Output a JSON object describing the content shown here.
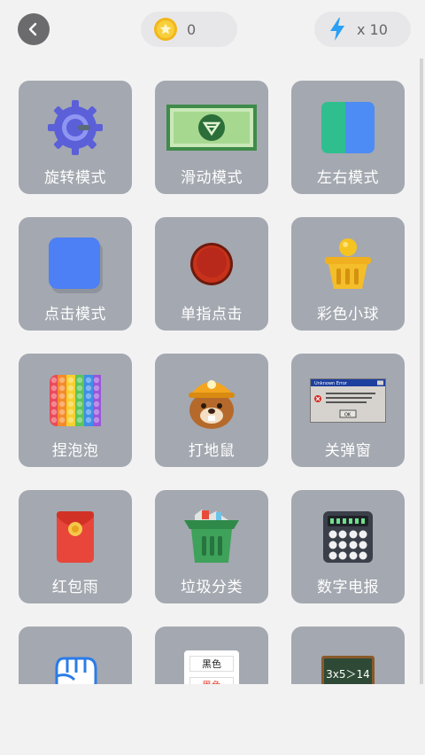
{
  "header": {
    "back_icon": "chevron-left-icon",
    "coins": {
      "icon": "coin-star-icon",
      "value": "0"
    },
    "energy": {
      "icon": "lightning-icon",
      "value": "x 10"
    }
  },
  "colors": {
    "background": "#f2f2f3",
    "card": "#a4a8b0",
    "back_button": "#6b6b6d",
    "pill": "#e7e7e9",
    "energy": "#2aa0f5",
    "coin": "#f4c12a"
  },
  "modes": [
    {
      "label": "旋转模式",
      "icon": "gear-icon"
    },
    {
      "label": "滑动模式",
      "icon": "banknote-icon"
    },
    {
      "label": "左右模式",
      "icon": "split-blocks-icon"
    },
    {
      "label": "点击模式",
      "icon": "blue-square-icon"
    },
    {
      "label": "单指点击",
      "icon": "red-button-icon"
    },
    {
      "label": "彩色小球",
      "icon": "basket-ball-icon"
    },
    {
      "label": "捏泡泡",
      "icon": "pop-it-icon"
    },
    {
      "label": "打地鼠",
      "icon": "mole-miner-icon"
    },
    {
      "label": "关弹窗",
      "icon": "error-popup-icon"
    },
    {
      "label": "红包雨",
      "icon": "red-envelope-icon"
    },
    {
      "label": "垃圾分类",
      "icon": "trash-bin-icon"
    },
    {
      "label": "数字电报",
      "icon": "telegraph-keypad-icon"
    },
    {
      "label": "",
      "icon": "fist-icon"
    },
    {
      "label": "",
      "icon": "color-word-cards-icon",
      "card_text": "黑色",
      "card_text_2": "黑色"
    },
    {
      "label": "",
      "icon": "math-blackboard-icon",
      "board_text": "3x5＞14"
    }
  ],
  "popup": {
    "title": "Unknown Error",
    "ok": "OK"
  }
}
